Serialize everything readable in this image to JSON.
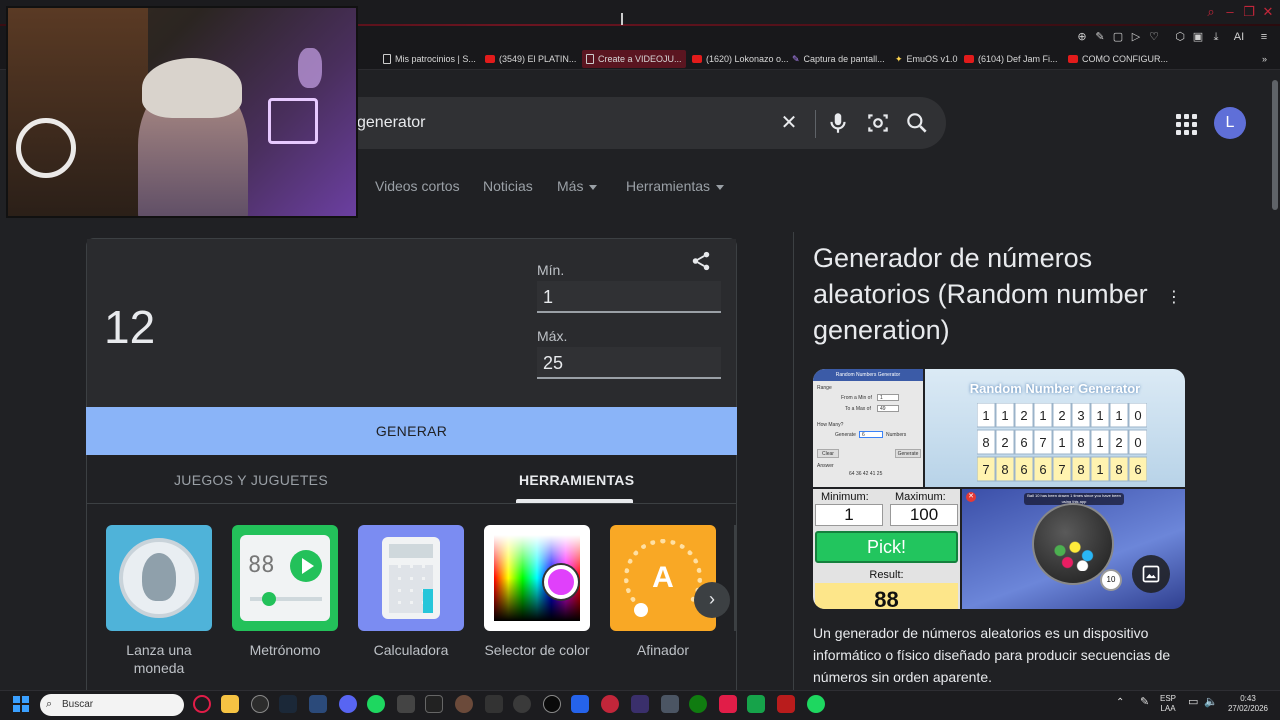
{
  "browser": {
    "bookmarks": [
      {
        "label": "Mis patrocinios | S...",
        "icon": "doc"
      },
      {
        "label": "(3549) El PLATIN...",
        "icon": "youtube"
      },
      {
        "label": "Create a VIDEOJU...",
        "icon": "doc"
      },
      {
        "label": "(1620) Lokonazo o...",
        "icon": "youtube"
      },
      {
        "label": "Captura de pantall...",
        "icon": "pen"
      },
      {
        "label": "EmuOS v1.0",
        "icon": "star"
      },
      {
        "label": "(6104) Def Jam Fi...",
        "icon": "youtube"
      },
      {
        "label": "COMO CONFIGUR...",
        "icon": "youtube"
      }
    ],
    "toolbar_ai_label": "AI"
  },
  "search": {
    "query": "generator",
    "avatar_letter": "L"
  },
  "nav_tabs": [
    {
      "label": "Videos cortos",
      "dropdown": false
    },
    {
      "label": "Noticias",
      "dropdown": false
    },
    {
      "label": "Más",
      "dropdown": true
    },
    {
      "label": "Herramientas",
      "dropdown": true
    }
  ],
  "rng": {
    "result": "12",
    "min_label": "Mín.",
    "min_value": "1",
    "max_label": "Máx.",
    "max_value": "25",
    "generate_label": "GENERAR",
    "category_tabs": [
      {
        "label": "JUEGOS Y JUGUETES",
        "active": false
      },
      {
        "label": "HERRAMIENTAS",
        "active": true
      }
    ],
    "tools": [
      {
        "label": "Lanza una moneda",
        "icon": "coin-icon"
      },
      {
        "label": "Metrónomo",
        "icon": "metronome-icon",
        "display": "88"
      },
      {
        "label": "Calculadora",
        "icon": "calculator-icon"
      },
      {
        "label": "Selector de color",
        "icon": "color-picker-icon"
      },
      {
        "label": "Afinador",
        "icon": "tuner-icon",
        "display": "A"
      }
    ]
  },
  "knowledge_panel": {
    "title": "Generador de números aleatorios (Random number generation)",
    "description": "Un generador de números aleatorios es un dispositivo informático o físico diseñado para producir secuencias de números sin orden aparente.",
    "image1": {
      "title": "Random Numbers Generator",
      "from_label": "From a Min of",
      "from_value": "1",
      "to_label": "To a Max of",
      "to_value": "49",
      "how_many_label": "How Many?",
      "generate_label": "Generate",
      "generate_value": "6",
      "numbers_label": "Numbers",
      "clear_label": "Clear",
      "generate_button": "Generate",
      "answer_label": "Answer",
      "answer_value": "64 36 42 41 25"
    },
    "image2": {
      "title": "Random Number Generator",
      "grid": [
        [
          "1",
          "1",
          "2",
          "1",
          "2",
          "3",
          "1",
          "1",
          "0"
        ],
        [
          "8",
          "2",
          "6",
          "7",
          "1",
          "8",
          "1",
          "2",
          "0"
        ],
        [
          "7",
          "8",
          "6",
          "6",
          "7",
          "8",
          "1",
          "8",
          "6"
        ]
      ]
    },
    "image3": {
      "min_label": "Minimum:",
      "max_label": "Maximum:",
      "min_value": "1",
      "max_value": "100",
      "pick_label": "Pick!",
      "result_label": "Result:",
      "result_value": "88"
    },
    "image4": {
      "caption": "Ball 10 has been drawn 1 times since you have been using this app",
      "ball_value": "10"
    }
  },
  "taskbar": {
    "search_placeholder": "Buscar",
    "lang_top": "ESP",
    "lang_bottom": "LAA",
    "time": "0:43",
    "date": "27/02/2026"
  }
}
